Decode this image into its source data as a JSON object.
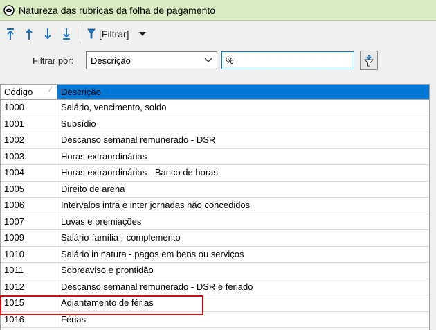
{
  "window": {
    "title": "Natureza das rubricas da folha de pagamento"
  },
  "toolbar": {
    "filter_label": "[Filtrar]"
  },
  "filter": {
    "caption": "Filtrar por:",
    "field_selected": "Descrição",
    "value": "%"
  },
  "grid": {
    "columns": {
      "code": "Código",
      "description": "Descrição"
    },
    "rows": [
      {
        "code": "1000",
        "description": "Salário, vencimento, soldo"
      },
      {
        "code": "1001",
        "description": "Subsídio"
      },
      {
        "code": "1002",
        "description": "Descanso semanal remunerado - DSR"
      },
      {
        "code": "1003",
        "description": "Horas extraordinárias"
      },
      {
        "code": "1004",
        "description": "Horas extraordinárias - Banco de horas"
      },
      {
        "code": "1005",
        "description": "Direito de arena"
      },
      {
        "code": "1006",
        "description": "Intervalos intra e inter jornadas não concedidos"
      },
      {
        "code": "1007",
        "description": "Luvas e premiações"
      },
      {
        "code": "1009",
        "description": "Salário-família - complemento"
      },
      {
        "code": "1010",
        "description": "Salário in natura - pagos em bens ou serviços"
      },
      {
        "code": "1011",
        "description": "Sobreaviso e prontidão"
      },
      {
        "code": "1012",
        "description": "Descanso semanal remunerado - DSR e feriado"
      },
      {
        "code": "1015",
        "description": "Adiantamento de férias"
      },
      {
        "code": "1016",
        "description": "Férias"
      }
    ]
  },
  "colors": {
    "title_bg": "#d9ebc3",
    "icon_blue": "#1a73c8",
    "selection": "#0078d7",
    "highlight": "#d01010"
  }
}
